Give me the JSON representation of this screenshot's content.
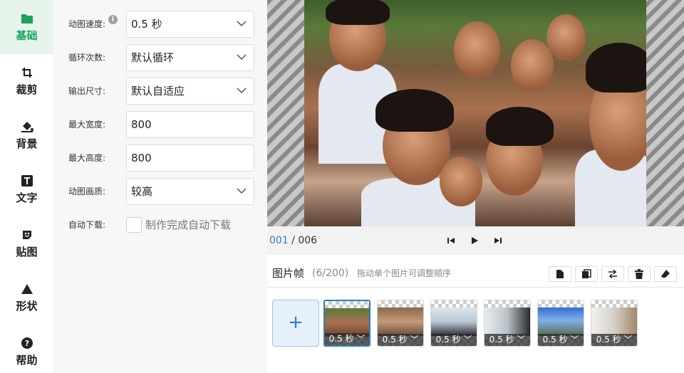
{
  "nav": {
    "items": [
      {
        "label": "基础",
        "icon": "folder-icon"
      },
      {
        "label": "裁剪",
        "icon": "crop-icon"
      },
      {
        "label": "背景",
        "icon": "paint-bucket-icon"
      },
      {
        "label": "文字",
        "icon": "text-icon"
      },
      {
        "label": "贴图",
        "icon": "sticker-icon"
      },
      {
        "label": "形状",
        "icon": "triangle-icon"
      },
      {
        "label": "帮助",
        "icon": "help-icon"
      }
    ],
    "active_index": 0
  },
  "settings": {
    "speed": {
      "label": "动图速度:",
      "value": "0.5 秒"
    },
    "loop": {
      "label": "循环次数:",
      "value": "默认循环"
    },
    "size": {
      "label": "输出尺寸:",
      "value": "默认自适应"
    },
    "max_width": {
      "label": "最大宽度:",
      "value": "800"
    },
    "max_height": {
      "label": "最大高度:",
      "value": "800"
    },
    "quality": {
      "label": "动图画质:",
      "value": "较高"
    },
    "auto_download": {
      "label": "自动下载:",
      "text": "制作完成自动下载"
    }
  },
  "player": {
    "current": "001",
    "separator": " / ",
    "total": "006"
  },
  "frames": {
    "title": "图片帧",
    "count": "(6/200)",
    "hint": "拖动单个图片可调整顺序",
    "items": [
      {
        "duration": "0.5 秒"
      },
      {
        "duration": "0.5 秒"
      },
      {
        "duration": "0.5 秒"
      },
      {
        "duration": "0.5 秒"
      },
      {
        "duration": "0.5 秒"
      },
      {
        "duration": "0.5 秒"
      }
    ],
    "add_label": "+"
  },
  "colors": {
    "accent_green": "#1aa260",
    "accent_blue": "#2e7cc4"
  }
}
